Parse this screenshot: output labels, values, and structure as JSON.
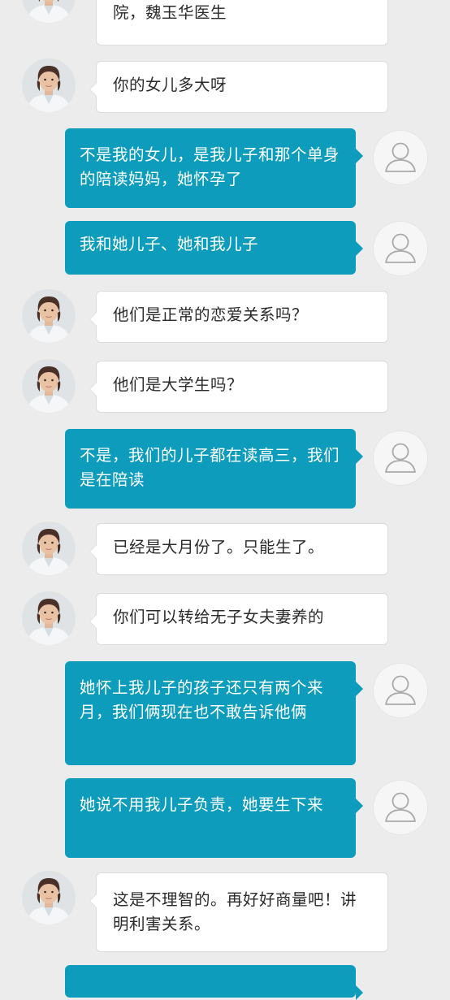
{
  "messages": [
    {
      "side": "in",
      "text": "这件事我想咨询北京大学人民医院，魏玉华医生",
      "partial_top": true
    },
    {
      "side": "in",
      "text": "你的女儿多大呀"
    },
    {
      "side": "out",
      "text": "不是我的女儿，是我儿子和那个单身的陪读妈妈，她怀孕了"
    },
    {
      "side": "out",
      "text": "我和她儿子、她和我儿子"
    },
    {
      "side": "in",
      "text": "他们是正常的恋爱关系吗？"
    },
    {
      "side": "in",
      "text": "他们是大学生吗？"
    },
    {
      "side": "out",
      "text": "不是，我们的儿子都在读高三，我们是在陪读"
    },
    {
      "side": "in",
      "text": "已经是大月份了。只能生了。"
    },
    {
      "side": "in",
      "text": "你们可以转给无子女夫妻养的"
    },
    {
      "side": "out",
      "text": "她怀上我儿子的孩子还只有两个来月，我们俩现在也不敢告诉他俩"
    },
    {
      "side": "out",
      "text": "她说不用我儿子负责，她要生下来"
    },
    {
      "side": "in",
      "text": "这是不理智的。再好好商量吧！讲明利害关系。"
    },
    {
      "side": "out",
      "text": "",
      "partial_bottom": true
    }
  ],
  "avatars": {
    "doctor": "doctor-photo",
    "user": "user-silhouette-icon"
  },
  "colors": {
    "background": "#ececec",
    "incoming_bubble": "#ffffff",
    "outgoing_bubble": "#0d9cbc",
    "incoming_text": "#2a2a2a",
    "outgoing_text": "#ffffff"
  }
}
